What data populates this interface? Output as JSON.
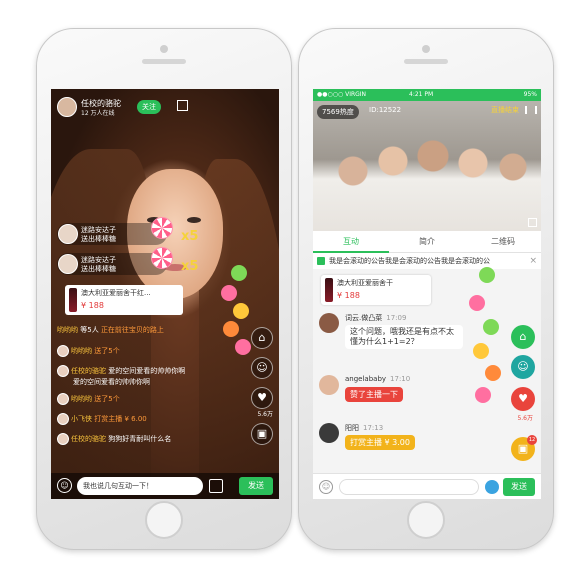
{
  "colors": {
    "accent_green": "#2bbf5a",
    "price_red": "#e23a3a",
    "gift_gold": "#f5d23a"
  },
  "live": {
    "host_name": "任校的骆驼",
    "host_sub": "12 万人在线",
    "follow_label": "关注",
    "gifts": [
      {
        "user": "迷路安达子",
        "text": "送出棒棒糖",
        "count": "x5"
      },
      {
        "user": "迷路安达子",
        "text": "送出棒棒糖",
        "count": "x5"
      }
    ],
    "product": {
      "name": "澳大利亚爱丽舍干红...",
      "price": "¥ 188"
    },
    "chat": [
      {
        "user": "哟哟哟",
        "text": "等5人",
        "extra": "正在前往宝贝的路上"
      },
      {
        "user": "哟哟哟",
        "text": "送了5个",
        "extra": "🌼"
      },
      {
        "user": "任校的骆驼",
        "text": "爱的空间爱看的帅帅你啊"
      },
      {
        "user": "",
        "text": "爱的空间爱看的帅帅你啊"
      },
      {
        "user": "哟哟哟",
        "text": "送了5个"
      },
      {
        "user": "小飞侠",
        "text": "打赏主播 ¥ 6.00"
      },
      {
        "user": "任校的骆驼",
        "text": "狗狗好青耐叫什么名"
      }
    ],
    "like_count": "5.6万",
    "input_text": "我也说几句互动一下！",
    "send_label": "发送",
    "icons": [
      "home-icon",
      "user-icon",
      "like-icon",
      "gift-icon"
    ]
  },
  "room": {
    "status_carrier": "●●○○○ VIRGIN",
    "status_time": "4:21 PM",
    "status_battery": "95%",
    "hots": "7569热度",
    "room_id": "ID:12522",
    "end_live": "直播结束",
    "tabs": [
      "互动",
      "简介",
      "二维码"
    ],
    "notice": "我是会滚动的公告我是会滚动的公告我是会滚动的公",
    "product": {
      "name": "澳大利亚爱丽舍干",
      "price": "¥ 188"
    },
    "messages": [
      {
        "user": "词云.做凸菜",
        "time": "17:09",
        "text": "这个问题，哦我还是有点不太懂为什么1+1=2？",
        "style": "white"
      },
      {
        "user": "angelababy",
        "time": "17:10",
        "text": "赞了主播一下",
        "style": "red"
      },
      {
        "user": "阳阳",
        "time": "17:13",
        "text": "打赏主播 ¥ 3.00",
        "style": "orange"
      }
    ],
    "like_count": "5.6万",
    "badge": "12",
    "send_label": "发送"
  }
}
